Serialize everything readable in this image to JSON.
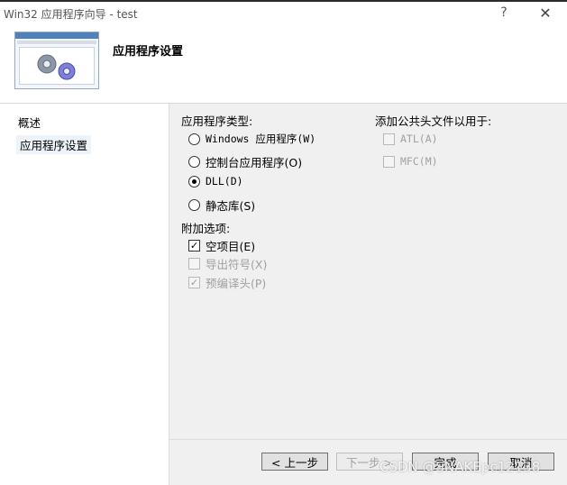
{
  "window": {
    "title": "Win32 应用程序向导 - test",
    "help": "?",
    "close": "✕"
  },
  "header": {
    "heading": "应用程序设置"
  },
  "nav": {
    "items": [
      {
        "label": "概述"
      },
      {
        "label": "应用程序设置"
      }
    ]
  },
  "app_type": {
    "label": "应用程序类型:",
    "options": [
      {
        "label": "Windows 应用程序(W)",
        "selected": false
      },
      {
        "label": "控制台应用程序(O)",
        "selected": false
      },
      {
        "label": "DLL(D)",
        "selected": true
      },
      {
        "label": "静态库(S)",
        "selected": false
      }
    ]
  },
  "extra": {
    "label": "附加选项:",
    "options": [
      {
        "label": "空项目(E)",
        "checked": true,
        "enabled": true
      },
      {
        "label": "导出符号(X)",
        "checked": false,
        "enabled": false
      },
      {
        "label": "预编译头(P)",
        "checked": true,
        "enabled": false
      }
    ]
  },
  "headers": {
    "label": "添加公共头文件以用于:",
    "options": [
      {
        "label": "ATL(A)",
        "checked": false,
        "enabled": false
      },
      {
        "label": "MFC(M)",
        "checked": false,
        "enabled": false
      }
    ]
  },
  "buttons": {
    "back": "< 上一步",
    "next": "下一步 >",
    "finish": "完成",
    "cancel": "取消"
  },
  "watermark": "CSDN @SNAKEpc12138"
}
